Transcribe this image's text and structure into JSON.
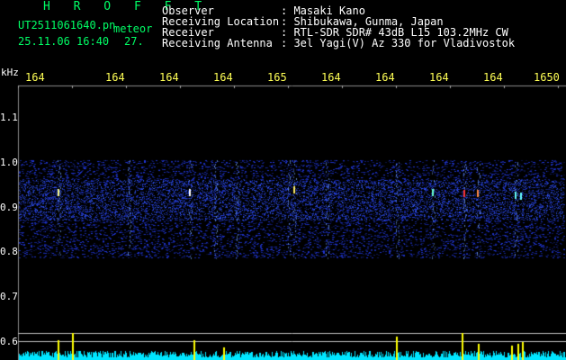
{
  "header": {
    "title": "H R O F F T",
    "filename": "UT2511061640.pn",
    "mode": "meteor",
    "datetime": "25.11.06 16:40",
    "count": "27.",
    "fields": [
      {
        "label": "Observer",
        "value": ": Masaki Kano"
      },
      {
        "label": "Receiving Location",
        "value": ": Shibukawa, Gunma, Japan"
      },
      {
        "label": "Receiver",
        "value": ": RTL-SDR SDR# 43dB L15 103.2MHz CW"
      },
      {
        "label": "Receiving Antenna",
        "value": ": 3el Yagi(V) Az 330 for Vladivostok"
      }
    ]
  },
  "axes": {
    "freq_unit": "kHz",
    "freq_ticks": [
      "164",
      "164",
      "164",
      "164",
      "165",
      "164",
      "164",
      "164",
      "164",
      "1650"
    ],
    "y_ticks": [
      "1.1",
      "1.0",
      "0.9",
      "0.8",
      "0.7",
      "0.6"
    ]
  },
  "colors": {
    "header_green": "#00ff66",
    "tick_yellow": "#ffff55",
    "signal_cyan": "#00e5ff",
    "band_blue": "#1a2cff"
  }
}
